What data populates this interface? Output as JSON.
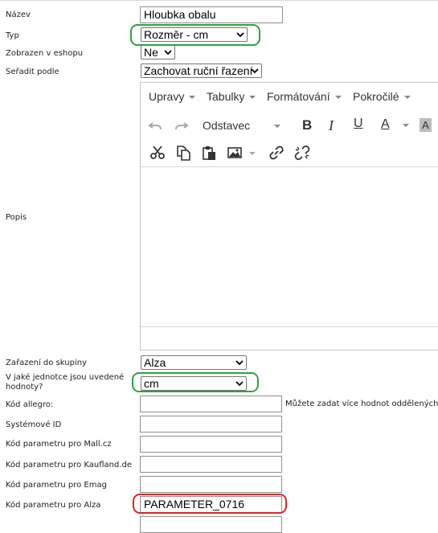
{
  "form": {
    "nazev": {
      "label": "Název",
      "value": "Hloubka obalu"
    },
    "typ": {
      "label": "Typ",
      "selected": "Rozměr - cm"
    },
    "zobrazen": {
      "label": "Zobrazen v eshopu",
      "selected": "Ne"
    },
    "seradit": {
      "label": "Seřadit podle",
      "selected": "Zachovat ruční řazení"
    },
    "popis": {
      "label": "Popis",
      "menu": [
        "Upravy",
        "Tabulky",
        "Formátování",
        "Pokročilé"
      ],
      "format_select": "Odstavec",
      "toolbar_letters": {
        "bold": "B",
        "italic": "I",
        "underline": "U",
        "font_color": "A",
        "bg_color": "A"
      }
    },
    "zarazeni": {
      "label": "Zařazení do skupiny",
      "selected": "Alza"
    },
    "jednotky": {
      "label": "V jaké jednotce jsou uvedené hodnoty?",
      "selected": "cm"
    },
    "allegro": {
      "label": "Kód allegro:",
      "value": "",
      "hint": "Můžete zadat více hodnot oddělených"
    },
    "systemove_id": {
      "label": "Systémové ID",
      "value": ""
    },
    "mall": {
      "label": "Kód parametru pro Mall.cz",
      "value": ""
    },
    "kaufland": {
      "label": "Kód parametru pro Kaufland.de",
      "value": ""
    },
    "emag": {
      "label": "Kód parametru pro Emag",
      "value": ""
    },
    "alza": {
      "label": "Kód parametru pro Alza",
      "value": "PARAMETER_0716"
    }
  },
  "colors": {
    "highlight_green": "#2aa63a",
    "highlight_red": "#d42a2a"
  }
}
